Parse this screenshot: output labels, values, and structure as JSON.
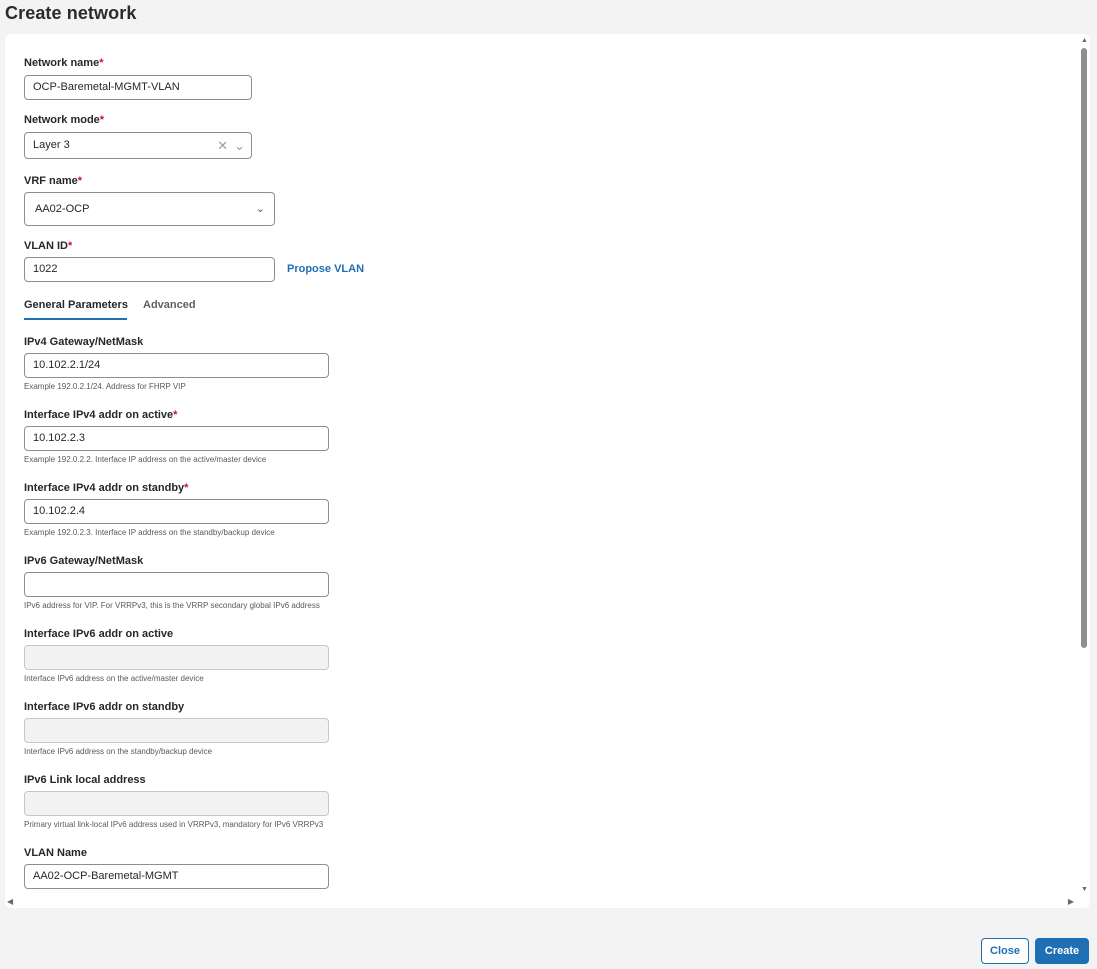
{
  "page": {
    "title": "Create network"
  },
  "form": {
    "network_name": {
      "label": "Network name",
      "required": "*",
      "value": "OCP-Baremetal-MGMT-VLAN"
    },
    "network_mode": {
      "label": "Network mode",
      "required": "*",
      "value": "Layer 3",
      "clear_icon": "close-icon",
      "chevron": "chevron-down-icon"
    },
    "vrf_name": {
      "label": "VRF name",
      "required": "*",
      "value": "AA02-OCP",
      "chevron": "chevron-down-icon"
    },
    "vlan_id": {
      "label": "VLAN ID",
      "required": "*",
      "value": "1022",
      "propose_link": "Propose VLAN"
    }
  },
  "tabs": [
    {
      "label": "General Parameters",
      "active": true
    },
    {
      "label": "Advanced",
      "active": false
    }
  ],
  "general": {
    "ipv4_gateway": {
      "label": "IPv4 Gateway/NetMask",
      "value": "10.102.2.1/24",
      "hint": "Example 192.0.2.1/24. Address for FHRP VIP"
    },
    "ipv4_active": {
      "label": "Interface IPv4 addr on active",
      "required": "*",
      "value": "10.102.2.3",
      "hint": "Example 192.0.2.2. Interface IP address on the active/master device"
    },
    "ipv4_standby": {
      "label": "Interface IPv4 addr on standby",
      "required": "*",
      "value": "10.102.2.4",
      "hint": "Example 192.0.2.3. Interface IP address on the standby/backup device"
    },
    "ipv6_gateway": {
      "label": "IPv6 Gateway/NetMask",
      "value": "",
      "hint": "IPv6 address for VIP. For VRRPv3, this is the VRRP secondary global IPv6 address"
    },
    "ipv6_active": {
      "label": "Interface IPv6 addr on active",
      "value": "",
      "hint": "Interface IPv6 address on the active/master device"
    },
    "ipv6_standby": {
      "label": "Interface IPv6 addr on standby",
      "value": "",
      "hint": "Interface IPv6 address on the standby/backup device"
    },
    "ipv6_link_local": {
      "label": "IPv6 Link local address",
      "value": "",
      "hint": "Primary virtual link-local IPv6 address used in VRRPv3, mandatory for IPv6 VRRPv3"
    },
    "vlan_name": {
      "label": "VLAN Name",
      "value": "AA02-OCP-Baremetal-MGMT"
    }
  },
  "footer": {
    "close_label": "Close",
    "create_label": "Create"
  },
  "colors": {
    "accent": "#1f6fb5",
    "required": "#c8102e",
    "background": "#f3f3f3",
    "panel": "#ffffff"
  }
}
